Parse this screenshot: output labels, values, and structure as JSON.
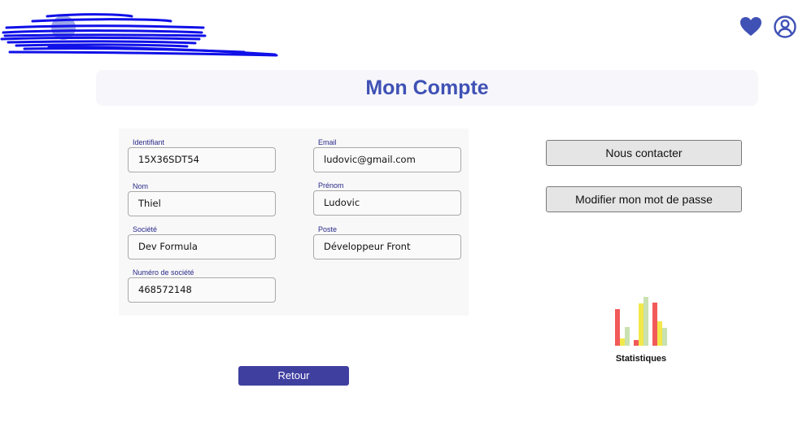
{
  "header": {
    "logo_icon": "redacted-logo",
    "favorites_icon": "heart-icon",
    "account_icon": "user-circle-icon",
    "accent_color": "#3f51b5"
  },
  "page": {
    "title": "Mon Compte"
  },
  "form": {
    "identifiant": {
      "label": "Identifiant",
      "value": "15X36SDT54"
    },
    "email": {
      "label": "Email",
      "value": "ludovic@gmail.com"
    },
    "nom": {
      "label": "Nom",
      "value": "Thiel"
    },
    "prenom": {
      "label": "Prénom",
      "value": "Ludovic"
    },
    "societe": {
      "label": "Société",
      "value": "Dev Formula"
    },
    "poste": {
      "label": "Poste",
      "value": "Développeur Front"
    },
    "numero_societe": {
      "label": "Numéro de société",
      "value": "468572148"
    }
  },
  "actions": {
    "contact_label": "Nous contacter",
    "change_password_label": "Modifier mon mot de passe",
    "back_label": "Retour",
    "back_color": "#3f3fa0"
  },
  "stats": {
    "label": "Statistiques",
    "icon": "bar-chart-icon"
  }
}
